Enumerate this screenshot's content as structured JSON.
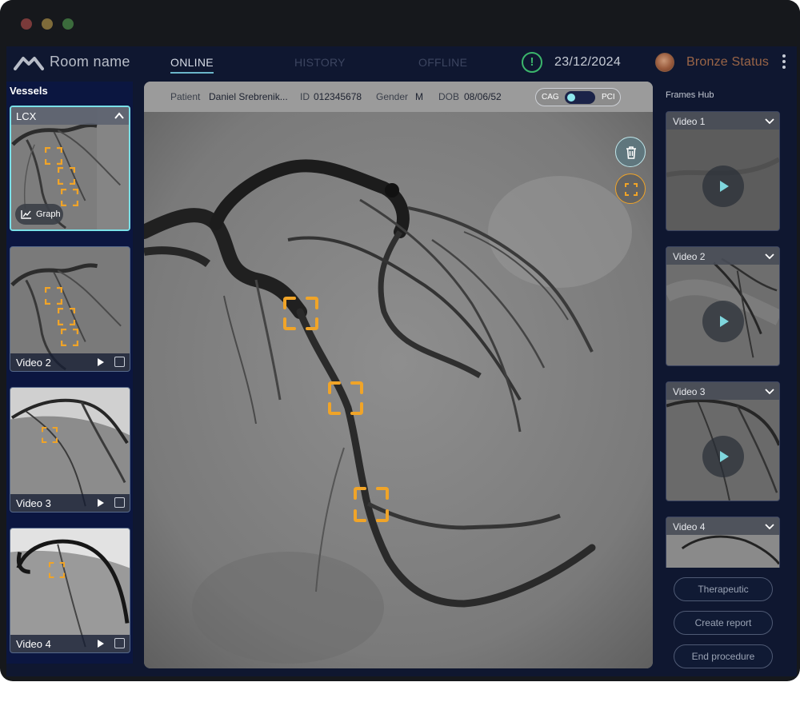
{
  "window": {
    "controls": [
      "close",
      "minimize",
      "maximize"
    ],
    "control_colors": {
      "close": "#7a3a3a",
      "minimize": "#7e6b3a",
      "maximize": "#3b6b3c"
    }
  },
  "header": {
    "logo_icon": "mountain-logo-icon",
    "room_name": "Room name",
    "tabs": [
      {
        "label": "ONLINE",
        "active": true
      },
      {
        "label": "HISTORY",
        "active": false
      },
      {
        "label": "OFFLINE",
        "active": false
      }
    ],
    "alert_icon": "exclamation-circle-icon",
    "alert_symbol": "!",
    "date": "23/12/2024",
    "status_label": "Bronze Status",
    "menu_icon": "kebab-menu-icon"
  },
  "vessels": {
    "title": "Vessels",
    "items": [
      {
        "label": "LCX",
        "active": true,
        "graph_label": "Graph",
        "expanded": true
      },
      {
        "label": "Video 2",
        "active": false
      },
      {
        "label": "Video 3",
        "active": false
      },
      {
        "label": "Video 4",
        "active": false
      }
    ]
  },
  "patient": {
    "patient_label": "Patient",
    "patient_value": "Daniel Srebrenik...",
    "id_label": "ID",
    "id_value": "012345678",
    "gender_label": "Gender",
    "gender_value": "M",
    "dob_label": "DOB",
    "dob_value": "08/06/52"
  },
  "mode_toggle": {
    "left": "CAG",
    "right": "PCI",
    "selected": "CAG"
  },
  "viewer_tools": [
    {
      "name": "trash",
      "icon": "trash-icon"
    },
    {
      "name": "focus",
      "icon": "focus-frame-icon"
    }
  ],
  "frames_hub": {
    "title": "Frames Hub",
    "items": [
      {
        "label": "Video 1"
      },
      {
        "label": "Video 2"
      },
      {
        "label": "Video 3"
      },
      {
        "label": "Video 4"
      }
    ]
  },
  "actions": {
    "therapeutic": "Therapeutic",
    "create_report": "Create report",
    "end_procedure": "End procedure"
  },
  "colors": {
    "accent_cyan": "#7ae0e8",
    "lesion_orange": "#f0a428",
    "status_bronze": "#9a6547",
    "alert_green": "#3bb56b",
    "app_bg": "#0f1730"
  }
}
